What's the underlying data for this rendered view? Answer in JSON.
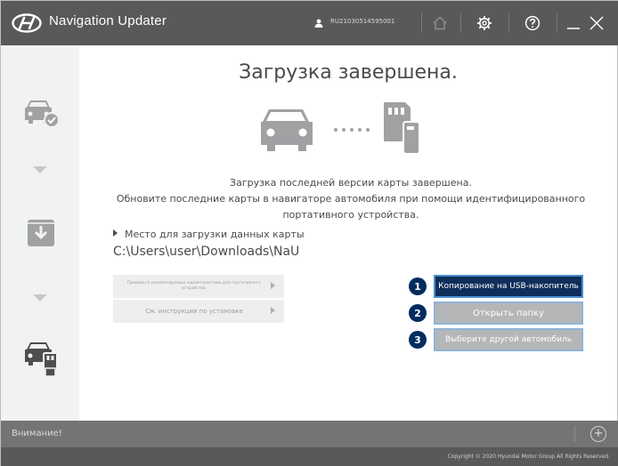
{
  "app": {
    "title": "Navigation Updater",
    "user_id": "RU21030514595001"
  },
  "titlebar": {
    "icons": [
      "hyundai-logo-icon",
      "user-icon",
      "home-icon",
      "settings-gear-icon",
      "help-icon",
      "minimize-icon",
      "close-icon"
    ]
  },
  "sidebar": {
    "steps": [
      {
        "name": "car-check-icon",
        "state": "done"
      },
      {
        "name": "download-icon",
        "state": "done"
      },
      {
        "name": "car-device-icon",
        "state": "active"
      }
    ]
  },
  "main": {
    "title": "Загрузка завершена.",
    "description": [
      "Загрузка последней версии карты завершена.",
      "Обновите последние карты в навигаторе автомобиля при помощи идентифицированного",
      "портативного устройства."
    ],
    "location_label": "Место для загрузки данных карты",
    "location_path": "C:\\Users\\user\\Downloads\\NaU",
    "links": [
      {
        "label": "Проверьте рекомендуемые характеристики для портативного устройства."
      },
      {
        "label": "См. инструкции по установке"
      }
    ],
    "actions": [
      {
        "number": "1",
        "label": "Копирование на USB-накопитель"
      },
      {
        "number": "2",
        "label": "Открыть папку"
      },
      {
        "number": "3",
        "label": "Выберите другой автомобиль"
      }
    ]
  },
  "notice": {
    "label": "Внимание!",
    "expand_symbol": "+"
  },
  "footer": {
    "copyright": "Copyright © 2020 Hyundai Motor Group All Rights Reserved."
  },
  "colors": {
    "titlebar": "#58595b",
    "accent": "#002c5f",
    "primary_button": "#0f2e5a",
    "secondary_button": "#b4b6b8",
    "sidebar": "#f1f2f2",
    "notice_bar": "#737476"
  }
}
